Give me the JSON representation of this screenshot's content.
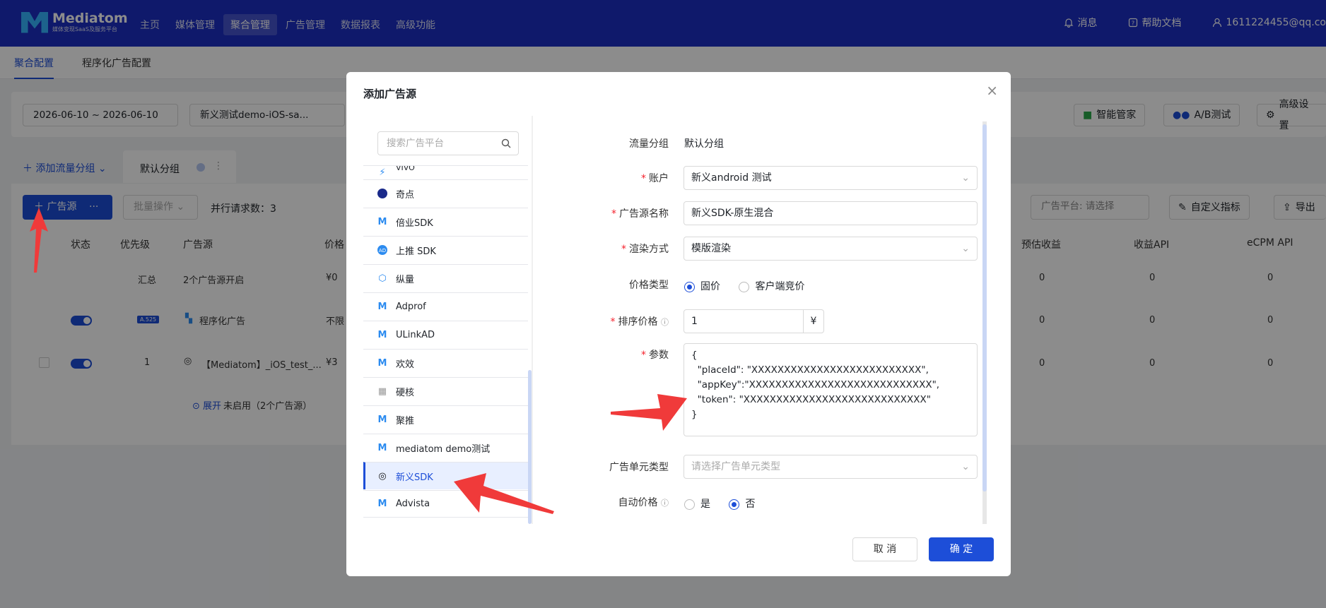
{
  "brand": {
    "name": "Mediatom",
    "tagline": "媒体变现SaaS及服务平台"
  },
  "nav": {
    "items": [
      "主页",
      "媒体管理",
      "聚合管理",
      "广告管理",
      "数据报表",
      "高级功能"
    ],
    "active": "聚合管理"
  },
  "top_right": {
    "messages": "消息",
    "docs": "帮助文档",
    "user": "1611224455@qq.co"
  },
  "subtabs": {
    "config": "聚合配置",
    "programmatic": "程序化广告配置"
  },
  "filters": {
    "date_range": "2026-06-10 ~ 2026-06-10",
    "app": "新义测试demo-iOS-sa..."
  },
  "filter_actions": {
    "smart": "智能管家",
    "ab": "A/B测试",
    "advanced": "高级设置"
  },
  "groups": {
    "add": "添加流量分组",
    "default": "默认分组"
  },
  "toolbar": {
    "add_source": "广告源",
    "batch": "批量操作",
    "parallel": "并行请求数：3",
    "platform_filter": "广告平台: 请选择",
    "custom_metrics": "自定义指标",
    "export": "导出"
  },
  "table": {
    "headers": [
      "状态",
      "优先级",
      "广告源",
      "价格",
      "预估收益",
      "收益API",
      "eCPM API"
    ],
    "summary": {
      "priority": "汇总",
      "source": "2个广告源开启",
      "price": "¥0",
      "est": "0",
      "api": "0",
      "ecpm": "0"
    },
    "row1": {
      "badge": "A.525",
      "source": "程序化广告",
      "price": "不限",
      "est": "0",
      "api": "0",
      "ecpm": "0"
    },
    "row2": {
      "priority": "1",
      "source": "【Mediatom】_iOS_test_...",
      "price": "¥3",
      "est": "0",
      "api": "0",
      "ecpm": "0"
    },
    "expand": "展开",
    "disabled_note": "未启用（2个广告源）"
  },
  "modal": {
    "title": "添加广告源",
    "search_placeholder": "搜索广告平台",
    "platforms": [
      "VIVO",
      "奇点",
      "倍业SDK",
      "上推 SDK",
      "纵量",
      "Adprof",
      "ULinkAD",
      "欢效",
      "硬核",
      "聚推",
      "mediatom demo测试",
      "新义SDK",
      "Advista"
    ],
    "selected_platform": "新义SDK",
    "form": {
      "group_label": "流量分组",
      "group_value": "默认分组",
      "account_label": "账户",
      "account_value": "新义android 测试",
      "name_label": "广告源名称",
      "name_value": "新义SDK-原生混合",
      "render_label": "渲染方式",
      "render_value": "模版渲染",
      "price_type_label": "价格类型",
      "price_fixed": "固价",
      "price_bid": "客户端竞价",
      "sort_price_label": "排序价格",
      "sort_price_value": "1",
      "currency": "¥",
      "params_label": "参数",
      "params_value": "{\n  \"placeId\": \"XXXXXXXXXXXXXXXXXXXXXXXXXX\",\n  \"appKey\":\"XXXXXXXXXXXXXXXXXXXXXXXXXXXX\",\n  \"token\": \"XXXXXXXXXXXXXXXXXXXXXXXXXXXX\"\n}",
      "unit_type_label": "广告单元类型",
      "unit_type_placeholder": "请选择广告单元类型",
      "auto_price_label": "自动价格",
      "yes": "是",
      "no": "否"
    },
    "cancel": "取 消",
    "confirm": "确 定"
  },
  "colors": {
    "primary": "#1d4ed8",
    "nav_bg": "#1d2fc4",
    "arrow": "#f03a3a"
  }
}
